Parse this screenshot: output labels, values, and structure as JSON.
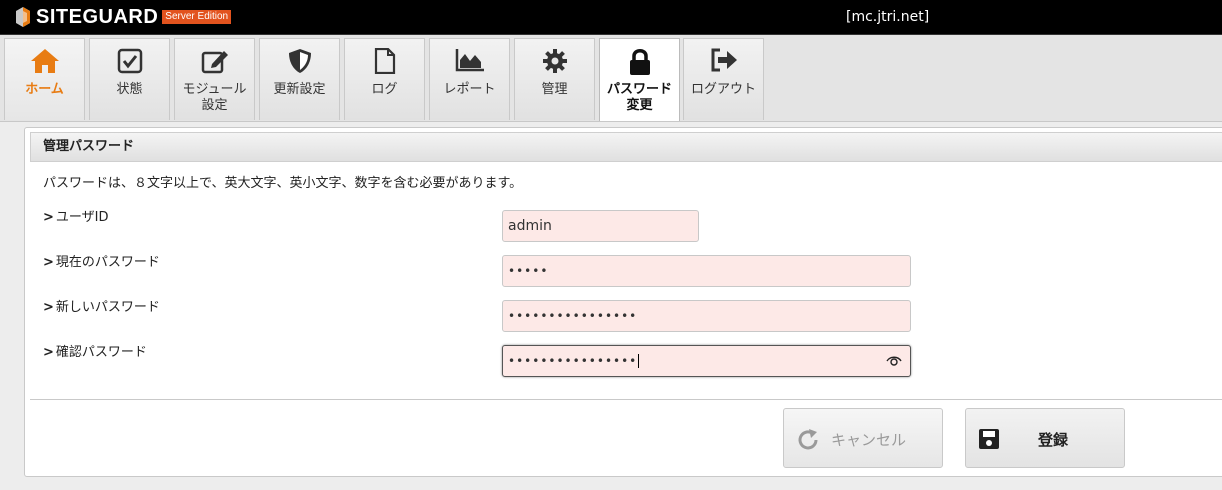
{
  "app": {
    "logo_text": "SITEGUARD",
    "edition_badge": "Server Edition",
    "host": "[mc.jtri.net]"
  },
  "tabs": [
    {
      "label": "ホーム",
      "icon": "home-icon"
    },
    {
      "label": "状態",
      "icon": "checkbox-icon"
    },
    {
      "label": "モジュール\n設定",
      "icon": "edit-icon"
    },
    {
      "label": "更新設定",
      "icon": "shield-icon"
    },
    {
      "label": "ログ",
      "icon": "document-icon"
    },
    {
      "label": "レポート",
      "icon": "chart-icon"
    },
    {
      "label": "管理",
      "icon": "gear-icon"
    },
    {
      "label": "パスワード\n変更",
      "icon": "lock-icon"
    },
    {
      "label": "ログアウト",
      "icon": "logout-icon"
    }
  ],
  "active_tab": "パスワード\n変更",
  "panel": {
    "title": "管理パスワード",
    "description": "パスワードは、８文字以上で、英大文字、英小文字、数字を含む必要があります。",
    "fields": {
      "user_id": {
        "label": "ユーザID",
        "value": "admin"
      },
      "current_password": {
        "label": "現在のパスワード",
        "value": "•••••"
      },
      "new_password": {
        "label": "新しいパスワード",
        "value": "••••••••••••••••"
      },
      "confirm_password": {
        "label": "確認パスワード",
        "value": "••••••••••••••••"
      }
    },
    "buttons": {
      "cancel": "キャンセル",
      "save": "登録"
    }
  },
  "colors": {
    "topbar": "#000000",
    "accent_home": "#e87c13",
    "badge": "#e2531e",
    "input_bg": "#fde9e7"
  }
}
